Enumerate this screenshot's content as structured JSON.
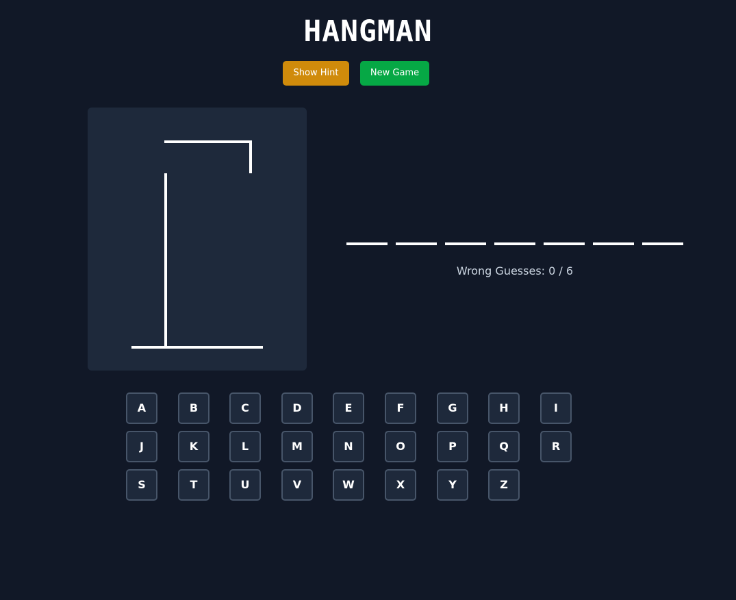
{
  "app": {
    "title": "HANGMAN"
  },
  "controls": {
    "hint_label": "Show Hint",
    "new_game_label": "New Game"
  },
  "colors": {
    "background": "#111827",
    "panel": "#1e293b",
    "hint_button": "#d08b0b",
    "new_game_button": "#06a845",
    "key_border": "#475569"
  },
  "word": {
    "letter_count": 7,
    "revealed": [
      "",
      "",
      "",
      "",
      "",
      "",
      ""
    ]
  },
  "status": {
    "wrong_guesses": 0,
    "max_guesses": 6,
    "text": "Wrong Guesses: 0 / 6"
  },
  "keyboard": {
    "rows": [
      [
        "A",
        "B",
        "C",
        "D",
        "E",
        "F",
        "G",
        "H",
        "I"
      ],
      [
        "J",
        "K",
        "L",
        "M",
        "N",
        "O",
        "P",
        "Q",
        "R"
      ],
      [
        "S",
        "T",
        "U",
        "V",
        "W",
        "X",
        "Y",
        "Z"
      ]
    ]
  }
}
